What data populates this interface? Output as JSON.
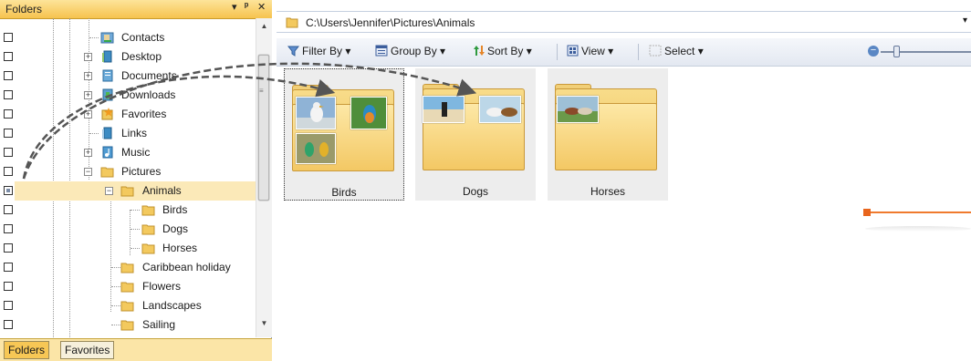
{
  "folders_panel": {
    "title": "Folders",
    "controls": {
      "dropdown": "▾",
      "pin": "ᵖ",
      "close": "✕"
    },
    "tree": [
      {
        "label": "Contacts",
        "icon": "contacts-folder-icon"
      },
      {
        "label": "Desktop",
        "icon": "desktop-folder-icon"
      },
      {
        "label": "Documents",
        "icon": "documents-folder-icon"
      },
      {
        "label": "Downloads",
        "icon": "downloads-folder-icon"
      },
      {
        "label": "Favorites",
        "icon": "favorites-folder-icon"
      },
      {
        "label": "Links",
        "icon": "links-folder-icon"
      },
      {
        "label": "Music",
        "icon": "music-folder-icon"
      },
      {
        "label": "Pictures",
        "icon": "folder-icon"
      },
      {
        "label": "Animals",
        "icon": "folder-icon",
        "selected": true
      },
      {
        "label": "Birds",
        "icon": "folder-icon"
      },
      {
        "label": "Dogs",
        "icon": "folder-icon"
      },
      {
        "label": "Horses",
        "icon": "folder-icon"
      },
      {
        "label": "Caribbean holiday",
        "icon": "folder-icon"
      },
      {
        "label": "Flowers",
        "icon": "folder-icon"
      },
      {
        "label": "Landscapes",
        "icon": "folder-icon"
      },
      {
        "label": "Sailing",
        "icon": "folder-icon"
      }
    ],
    "tabs": [
      "Folders",
      "Favorites"
    ]
  },
  "address_bar": {
    "path": "C:\\Users\\Jennifer\\Pictures\\Animals"
  },
  "toolbar": {
    "filter_label": "Filter By",
    "group_label": "Group By",
    "sort_label": "Sort By",
    "view_label": "View",
    "select_label": "Select"
  },
  "tiles": [
    {
      "name": "Birds"
    },
    {
      "name": "Dogs"
    },
    {
      "name": "Horses"
    }
  ],
  "colors": {
    "panel_header": "#f6c34e",
    "selection": "#fbe9b8",
    "annotation": "#f07a2e"
  }
}
